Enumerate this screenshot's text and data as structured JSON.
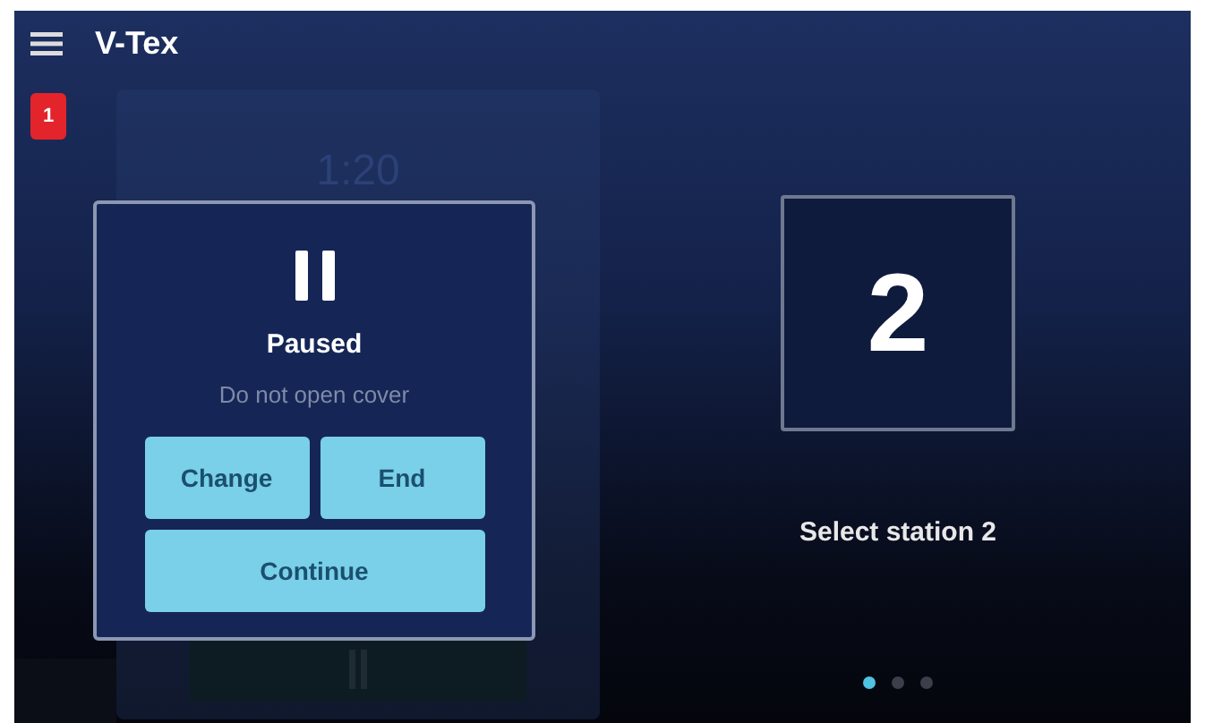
{
  "app_bar": {
    "title": "V-Tex"
  },
  "station_1": {
    "badge": "1",
    "timer": "1:20"
  },
  "dialog": {
    "status": "Paused",
    "message": "Do not open cover",
    "buttons": [
      {
        "label": "Change",
        "wide": false
      },
      {
        "label": "End",
        "wide": false
      },
      {
        "label": "Continue",
        "wide": true
      }
    ]
  },
  "station_2": {
    "number": "2",
    "caption": "Select station 2"
  },
  "pager": [
    {
      "selected": true
    },
    {
      "selected": false
    },
    {
      "selected": false
    }
  ]
}
